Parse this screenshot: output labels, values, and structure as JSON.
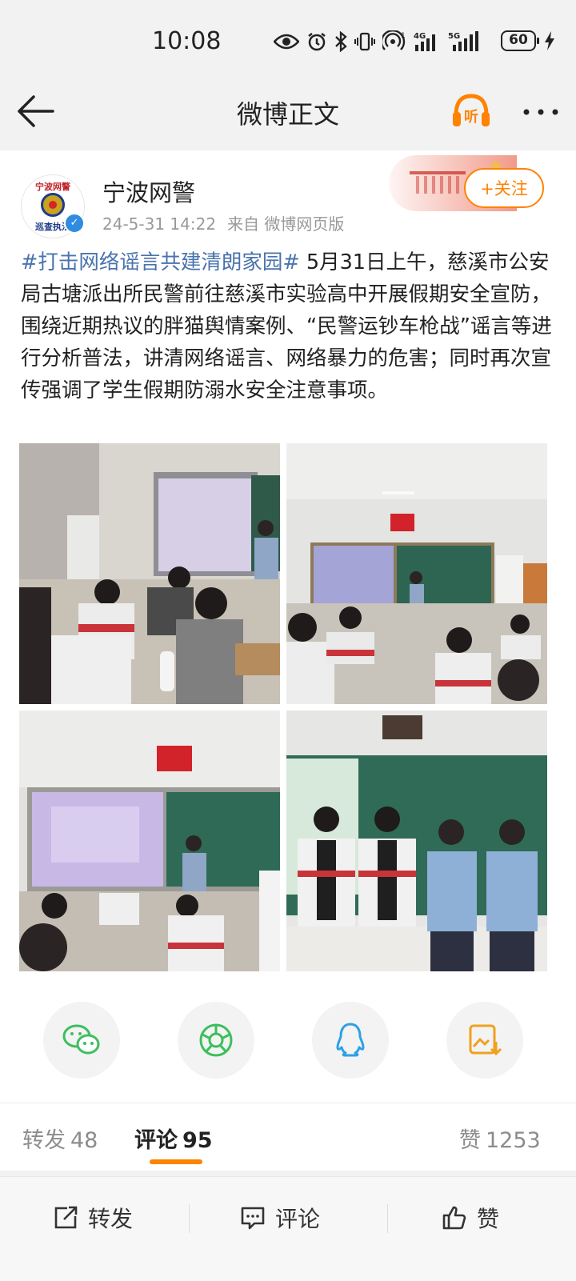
{
  "status_bar": {
    "time": "10:08",
    "network_1": "4G",
    "network_2": "5G",
    "battery": "60",
    "icons": [
      "eye-icon",
      "alarm-icon",
      "bluetooth-icon",
      "vibrate-icon",
      "hotspot-icon",
      "signal-4g-icon",
      "signal-5g-icon",
      "battery-icon",
      "charging-icon"
    ]
  },
  "nav": {
    "title": "微博正文",
    "listen_label": "听",
    "accent": "#ff8200"
  },
  "post": {
    "author": "宁波网警",
    "avatar_text_top": "宁波网警",
    "avatar_text_bottom": "巡查执法",
    "verified_mark": "✓",
    "date": "24-5-31 14:22",
    "source": "来自 微博网页版",
    "follow_label": "+关注",
    "hashtag": "#打击网络谣言共建清朗家园#",
    "body": " 5月31日上午，慈溪市公安局古塘派出所民警前往慈溪市实验高中开展假期安全宣防，围绕近期热议的胖猫舆情案例、“民警运钞车枪战”谣言等进行分析普法，讲清网络谣言、网络暴力的危害；同时再次宣传强调了学生假期防溺水安全注意事项。",
    "hashtag_color": "#4a73ad"
  },
  "share": {
    "items": [
      "wechat-icon",
      "moments-icon",
      "qq-icon",
      "save-image-icon"
    ]
  },
  "tabs": {
    "repost_label": "转发",
    "repost_count": "48",
    "comment_label": "评论",
    "comment_count": "95",
    "like_label": "赞",
    "like_count": "1253"
  },
  "bottom_bar": {
    "repost": "转发",
    "comment": "评论",
    "like": "赞"
  }
}
